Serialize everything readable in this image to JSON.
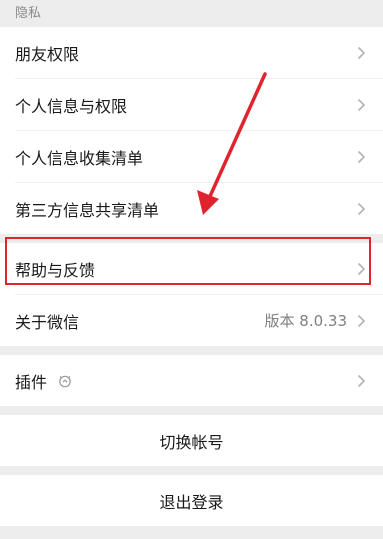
{
  "privacy": {
    "section_title": "隐私",
    "items": [
      {
        "label": "朋友权限"
      },
      {
        "label": "个人信息与权限"
      },
      {
        "label": "个人信息收集清单"
      },
      {
        "label": "第三方信息共享清单"
      }
    ]
  },
  "help": {
    "label": "帮助与反馈"
  },
  "about": {
    "label": "关于微信",
    "version": "版本 8.0.33"
  },
  "plugins": {
    "label": "插件"
  },
  "switch_account": {
    "label": "切换帐号"
  },
  "logout": {
    "label": "退出登录"
  },
  "annotation": {
    "highlight_color": "#e0242d"
  },
  "icons": {
    "chevron": "chevron-right-icon",
    "plugin": "plugin-icon"
  }
}
